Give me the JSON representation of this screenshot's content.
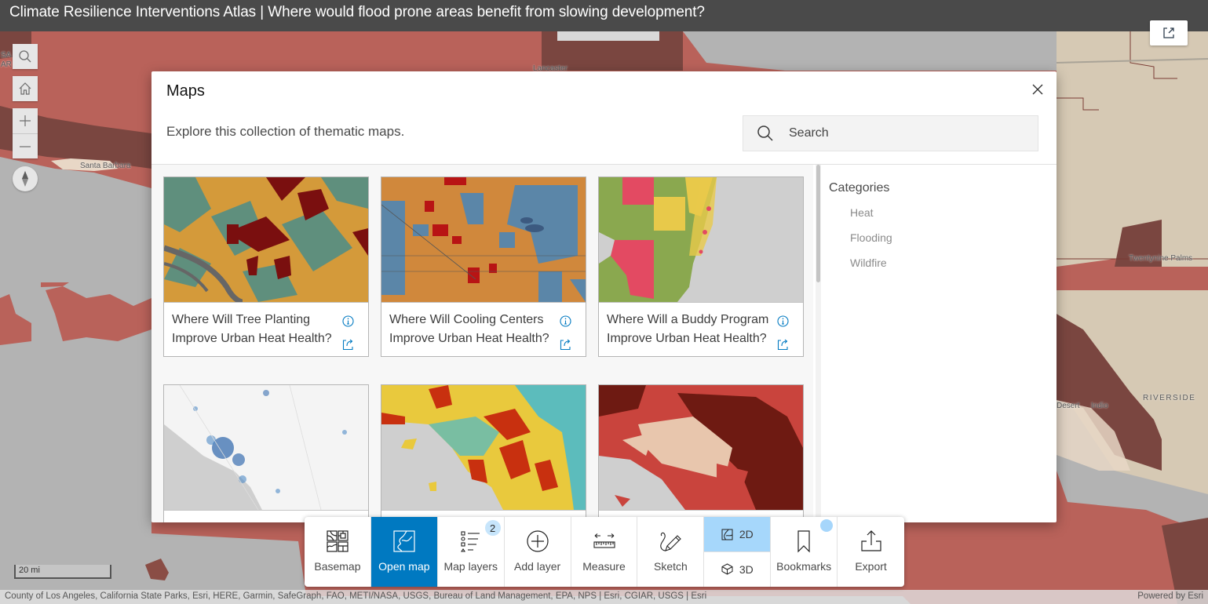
{
  "header": {
    "title": "Climate Resilience Interventions Atlas | Where would flood prone areas benefit from slowing development?",
    "launch_icon": "external-link-icon"
  },
  "map": {
    "labels": {
      "santa_barbara": "Santa Barbara",
      "lancaster": "Lancaster",
      "twentynine_palms": "Twentynine Palms",
      "riverside": "RIVERSIDE",
      "indio": "Indio",
      "desert": "Desert",
      "sa": "SA",
      "ar": "AR"
    },
    "widgets": {
      "search_icon": "search-icon",
      "home_icon": "home-icon",
      "zoom_in": "+",
      "zoom_out": "−",
      "compass_icon": "compass-icon"
    },
    "scale": "20 mi",
    "attribution": "County of Los Angeles, California State Parks, Esri, HERE, Garmin, SafeGraph, FAO, METI/NASA, USGS, Bureau of Land Management, EPA, NPS | Esri, CGIAR, USGS | Esri",
    "powered_by": "Powered by Esri",
    "colors": {
      "risk_high": "#b9625a",
      "risk_very_high": "#7a4640",
      "terrain": "#d6c9b4",
      "water": "#b3b3b3"
    }
  },
  "dialog": {
    "title": "Maps",
    "subtitle": "Explore this collection of thematic maps.",
    "search_placeholder": "Search",
    "close_icon": "close-icon",
    "cards": [
      {
        "title": "Where Will Tree Planting Improve Urban Heat Health?",
        "thumbnail": "washington-dc-tree-map"
      },
      {
        "title": "Where Will Cooling Centers Improve Urban Heat Health?",
        "thumbnail": "phoenix-cooling-map"
      },
      {
        "title": "Where Will a Buddy Program Improve Urban Heat Health?",
        "thumbnail": "south-florida-buddy-map"
      },
      {
        "title": "",
        "thumbnail": "california-blue-map"
      },
      {
        "title": "",
        "thumbnail": "socal-yellow-teal-map"
      },
      {
        "title": "",
        "thumbnail": "socal-red-map"
      }
    ],
    "categories": {
      "title": "Categories",
      "items": [
        "Heat",
        "Flooding",
        "Wildfire"
      ]
    }
  },
  "toolbar": {
    "items": [
      {
        "label": "Basemap",
        "icon": "basemap-icon",
        "active": false
      },
      {
        "label": "Open map",
        "icon": "open-map-icon",
        "active": true
      },
      {
        "label": "Map layers",
        "icon": "layers-list-icon",
        "active": false,
        "badge": "2"
      },
      {
        "label": "Add layer",
        "icon": "add-circle-icon",
        "active": false
      },
      {
        "label": "Measure",
        "icon": "measure-ruler-icon",
        "active": false
      },
      {
        "label": "Sketch",
        "icon": "sketch-pencil-icon",
        "active": false
      }
    ],
    "view_toggle": {
      "option_2d": "2D",
      "option_3d": "3D",
      "selected": "2D"
    },
    "bookmarks": {
      "label": "Bookmarks",
      "icon": "bookmark-icon"
    },
    "export": {
      "label": "Export",
      "icon": "export-icon"
    },
    "accent_color": "#0079c1"
  }
}
